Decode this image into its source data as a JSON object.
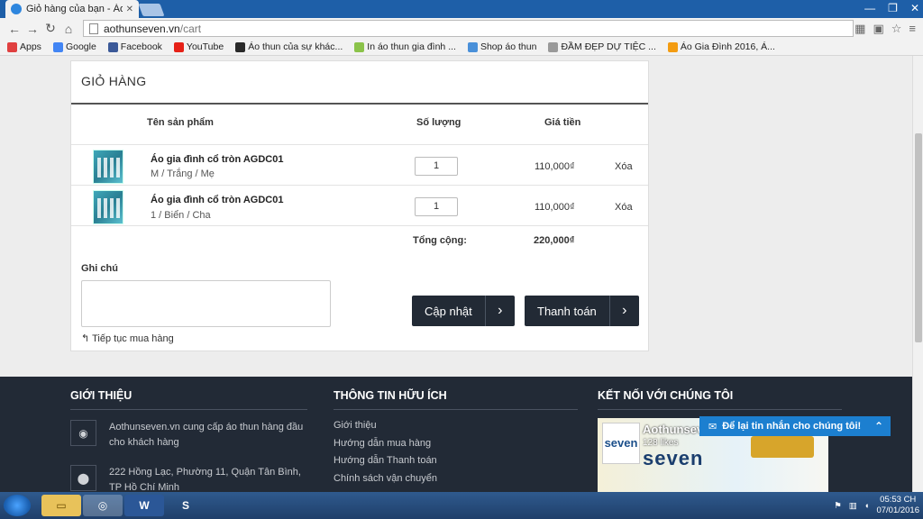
{
  "browser": {
    "tab_title": "Giỏ hàng của bạn - Áo Thu",
    "url_domain": "aothunseven.vn",
    "url_path": "/cart",
    "bookmarks": [
      {
        "label": "Apps",
        "color": "#e04040"
      },
      {
        "label": "Google",
        "color": "#4285f4"
      },
      {
        "label": "Facebook",
        "color": "#3b5998"
      },
      {
        "label": "YouTube",
        "color": "#e62117"
      },
      {
        "label": "Áo thun của sự khác...",
        "color": "#2a2a2a"
      },
      {
        "label": "In áo thun gia đình ...",
        "color": "#8bc34a"
      },
      {
        "label": "Shop áo thun",
        "color": "#4a90d9"
      },
      {
        "label": "ĐẦM ĐẸP DỰ TIỆC ...",
        "color": "#999999"
      },
      {
        "label": "Áo Gia Đình 2016, Á...",
        "color": "#f39c12"
      }
    ]
  },
  "cart": {
    "title": "GIỎ HÀNG",
    "columns": {
      "product": "Tên sản phẩm",
      "quantity": "Số lượng",
      "price": "Giá tiền"
    },
    "items": [
      {
        "name": "Áo gia đình cổ tròn AGDC01",
        "variant": "M / Trắng / Mẹ",
        "quantity": "1",
        "price": "110,000₫",
        "remove": "Xóa"
      },
      {
        "name": "Áo gia đình cổ tròn AGDC01",
        "variant": "1 / Biển / Cha",
        "quantity": "1",
        "price": "110,000₫",
        "remove": "Xóa"
      }
    ],
    "total_label": "Tổng cộng:",
    "total_value": "220,000₫",
    "note_label": "Ghi chú",
    "continue_label": "Tiếp tục mua hàng",
    "update_button": "Cập nhật",
    "checkout_button": "Thanh toán"
  },
  "footer": {
    "about": {
      "heading": "GIỚI THIỆU",
      "description": "Aothunseven.vn cung cấp áo thun hàng đầu cho khách hàng",
      "address": "222 Hồng Lạc, Phường 11, Quận Tân Bình, TP Hồ Chí Minh"
    },
    "info": {
      "heading": "THÔNG TIN HỮU ÍCH",
      "links": [
        "Giới thiệu",
        "Hướng dẫn mua hàng",
        "Hướng dẫn Thanh toán",
        "Chính sách vận chuyển"
      ]
    },
    "connect": {
      "heading": "KẾT NỐI VỚI CHÚNG TÔI",
      "page_name": "Aothunseven.vn",
      "likes": "128 likes"
    },
    "chat_label": "Để lại tin nhắn cho chúng tôi!"
  },
  "taskbar": {
    "time": "05:53 CH",
    "date": "07/01/2016"
  }
}
